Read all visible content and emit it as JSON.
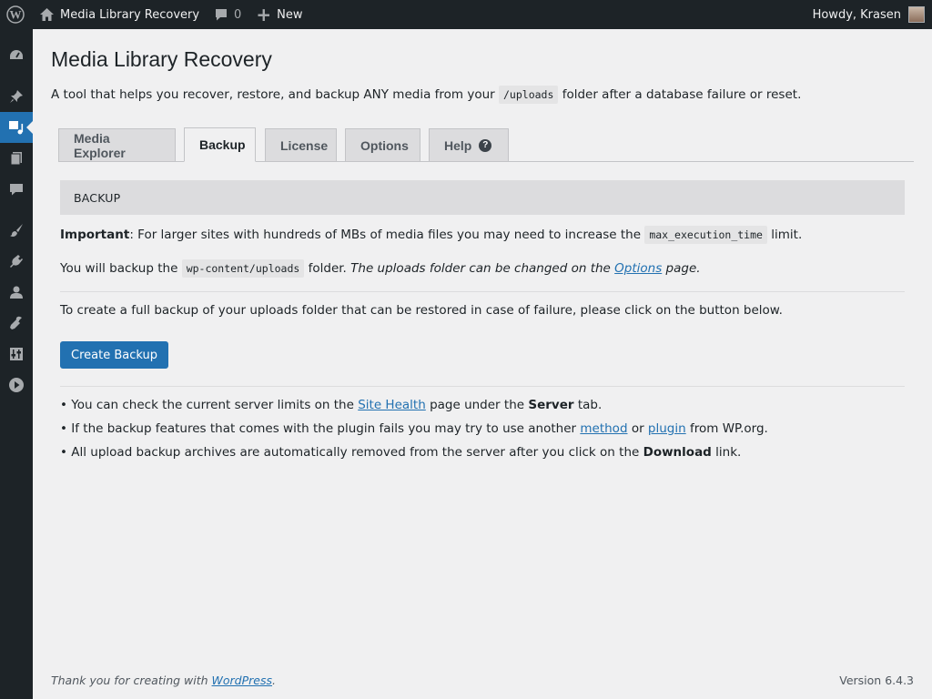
{
  "adminbar": {
    "site_name": "Media Library Recovery",
    "comments_count": "0",
    "new_label": "New",
    "howdy": "Howdy, Krasen"
  },
  "page": {
    "title": "Media Library Recovery",
    "intro_before": "A tool that helps you recover, restore, and backup ANY media from your",
    "intro_code": "/uploads",
    "intro_after": "folder after a database failure or reset."
  },
  "tabs": [
    {
      "label": "Media Explorer"
    },
    {
      "label": "Backup"
    },
    {
      "label": "License"
    },
    {
      "label": "Options"
    },
    {
      "label": "Help"
    }
  ],
  "backup": {
    "section_title": "BACKUP",
    "important_label": "Important",
    "important_text": ": For larger sites with hundreds of MBs of media files you may need to increase the",
    "important_code": "max_execution_time",
    "important_after": "limit.",
    "path_before": "You will backup the",
    "path_code": "wp-content/uploads",
    "path_after": "folder.",
    "path_note_before": "The uploads folder can be changed on the",
    "path_note_link": "Options",
    "path_note_after": "page.",
    "create_text": "To create a full backup of your uploads folder that can be restored in case of failure, please click on the button below.",
    "create_button": "Create Backup"
  },
  "notes": {
    "n1_before": "• You can check the current server limits on the",
    "n1_link": "Site Health",
    "n1_mid": "page under the",
    "n1_bold": "Server",
    "n1_after": "tab.",
    "n2_before": "• If the backup features that comes with the plugin fails you may try to use another",
    "n2_link1": "method",
    "n2_mid": "or",
    "n2_link2": "plugin",
    "n2_after": "from WP.org.",
    "n3_before": "• All upload backup archives are automatically removed from the server after you click on the",
    "n3_bold": "Download",
    "n3_after": "link."
  },
  "footer": {
    "thanks_before": "Thank you for creating with",
    "thanks_link": "WordPress",
    "thanks_after": ".",
    "version": "Version 6.4.3"
  }
}
